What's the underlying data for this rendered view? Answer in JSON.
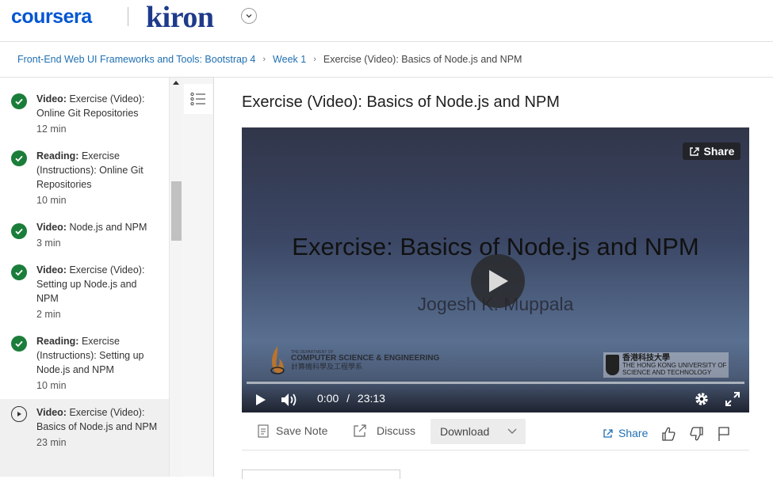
{
  "header": {
    "brand": "coursera",
    "partner": "kiron"
  },
  "breadcrumb": {
    "course": "Front-End Web UI Frameworks and Tools: Bootstrap 4",
    "week": "Week 1",
    "current": "Exercise (Video): Basics of Node.js and NPM"
  },
  "sidebar": {
    "items": [
      {
        "type": "Video:",
        "line1": "Exercise (Video):",
        "rest": "Online Git Repositories",
        "duration": "12 min",
        "status": "complete"
      },
      {
        "type": "Reading:",
        "line1": "Exercise",
        "rest": "(Instructions): Online Git Repositories",
        "duration": "10 min",
        "status": "complete"
      },
      {
        "type": "Video:",
        "line1": "Node.js and NPM",
        "rest": "",
        "duration": "3 min",
        "status": "complete"
      },
      {
        "type": "Video:",
        "line1": "Exercise (Video):",
        "rest": "Setting up Node.js and NPM",
        "duration": "2 min",
        "status": "complete"
      },
      {
        "type": "Reading:",
        "line1": "Exercise",
        "rest": "(Instructions): Setting up Node.js and NPM",
        "duration": "10 min",
        "status": "complete"
      },
      {
        "type": "Video:",
        "line1": "Exercise (Video):",
        "rest": "Basics of Node.js and NPM",
        "duration": "23 min",
        "status": "current"
      }
    ]
  },
  "main": {
    "title": "Exercise (Video): Basics of Node.js and NPM"
  },
  "video": {
    "slide_title": "Exercise: Basics of Node.js and NPM",
    "slide_author": "Jogesh K. Muppala",
    "share_label": "Share",
    "logo_left_small": "THE DEPARTMENT OF",
    "logo_left_main": "COMPUTER SCIENCE & ENGINEERING",
    "logo_left_cn": "計算機科學及工程學系",
    "logo_right_cn": "香港科技大學",
    "logo_right_en1": "THE HONG KONG UNIVERSITY OF",
    "logo_right_en2": "SCIENCE AND TECHNOLOGY",
    "current_time": "0:00",
    "time_sep": "/",
    "duration": "23:13",
    "progress": 0
  },
  "actions": {
    "save_note": "Save Note",
    "discuss": "Discuss",
    "download": "Download",
    "share": "Share"
  },
  "colors": {
    "brand": "#0056d2",
    "link": "#1f6fb2",
    "complete": "#1b7d3a"
  }
}
